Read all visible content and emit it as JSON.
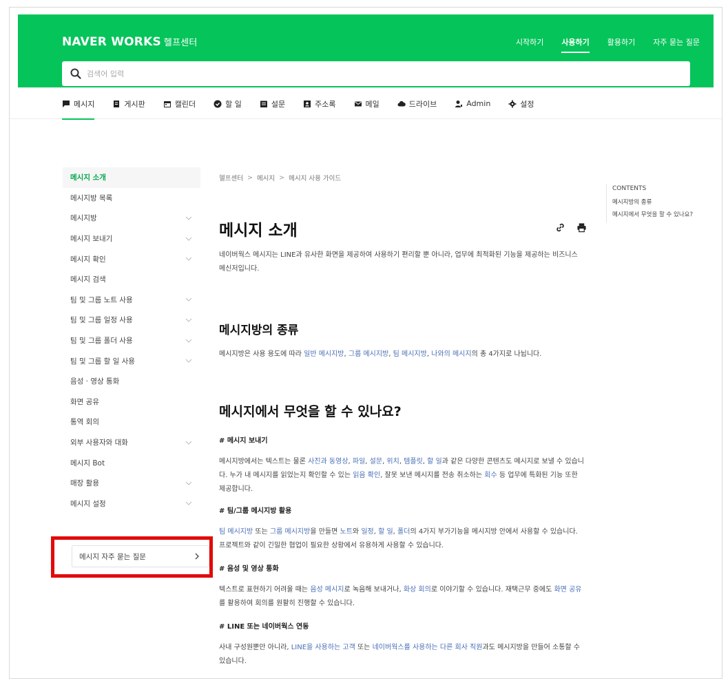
{
  "brand": {
    "name": "NAVER WORKS",
    "sub": "헬프센터"
  },
  "topnav": [
    {
      "label": "시작하기",
      "active": false
    },
    {
      "label": "사용하기",
      "active": true
    },
    {
      "label": "활용하기",
      "active": false
    },
    {
      "label": "자주 묻는 질문",
      "active": false
    }
  ],
  "search": {
    "placeholder": "검색어 입력"
  },
  "tabs": [
    {
      "label": "메시지",
      "icon": "message-icon",
      "active": true
    },
    {
      "label": "게시판",
      "icon": "board-icon"
    },
    {
      "label": "캘린더",
      "icon": "calendar-icon"
    },
    {
      "label": "할 일",
      "icon": "check-circle-icon"
    },
    {
      "label": "설문",
      "icon": "survey-icon"
    },
    {
      "label": "주소록",
      "icon": "contact-icon"
    },
    {
      "label": "메일",
      "icon": "mail-icon"
    },
    {
      "label": "드라이브",
      "icon": "cloud-icon"
    },
    {
      "label": "Admin",
      "icon": "admin-icon"
    },
    {
      "label": "설정",
      "icon": "gear-icon"
    }
  ],
  "sidebar": {
    "items": [
      {
        "label": "메시지 소개",
        "expandable": false,
        "active": true
      },
      {
        "label": "메시지방 목록",
        "expandable": false
      },
      {
        "label": "메시지방",
        "expandable": true
      },
      {
        "label": "메시지 보내기",
        "expandable": true
      },
      {
        "label": "메시지 확인",
        "expandable": true
      },
      {
        "label": "메시지 검색",
        "expandable": false
      },
      {
        "label": "팀 및 그룹 노트 사용",
        "expandable": true
      },
      {
        "label": "팀 및 그룹 일정 사용",
        "expandable": true
      },
      {
        "label": "팀 및 그룹 폴더 사용",
        "expandable": true
      },
      {
        "label": "팀 및 그룹 할 일 사용",
        "expandable": true
      },
      {
        "label": "음성 · 영상 통화",
        "expandable": false
      },
      {
        "label": "화면 공유",
        "expandable": false
      },
      {
        "label": "통역 회의",
        "expandable": false
      },
      {
        "label": "외부 사용자와 대화",
        "expandable": true
      },
      {
        "label": "메시지 Bot",
        "expandable": false
      },
      {
        "label": "매장 활용",
        "expandable": true
      },
      {
        "label": "메시지 설정",
        "expandable": true
      }
    ],
    "faq_label": "메시지 자주 묻는 질문"
  },
  "breadcrumb": [
    "헬프센터",
    "메시지",
    "메시지 사용 가이드"
  ],
  "page": {
    "title": "메시지 소개",
    "intro": "네이버웍스 메시지는 LINE과 유사한 화면을 제공하여 사용하기 편리할 뿐 아니라, 업무에 최적화된 기능을 제공하는 비즈니스 메신저입니다.",
    "s1": {
      "title": "메시지방의 종류",
      "p": [
        {
          "t": "메시지방은 사용 용도에 따라 "
        },
        {
          "t": "일반 메시지방",
          "link": true
        },
        {
          "t": ", "
        },
        {
          "t": "그룹 메시지방",
          "link": true
        },
        {
          "t": ", "
        },
        {
          "t": "팀 메시지방",
          "link": true
        },
        {
          "t": ", "
        },
        {
          "t": "나와의 메시지",
          "link": true
        },
        {
          "t": "의 총 4가지로 나뉩니다."
        }
      ]
    },
    "s2": {
      "title": "메시지에서 무엇을 할 수 있나요?",
      "sub1": {
        "title": "# 메시지 보내기",
        "p": [
          {
            "t": "메시지방에서는 텍스트는 물론 "
          },
          {
            "t": "사진과 동영상",
            "link": true
          },
          {
            "t": ", "
          },
          {
            "t": "파일",
            "link": true
          },
          {
            "t": ", "
          },
          {
            "t": "설문",
            "link": true
          },
          {
            "t": ", "
          },
          {
            "t": "위치",
            "link": true
          },
          {
            "t": ", "
          },
          {
            "t": "템플릿",
            "link": true
          },
          {
            "t": ", "
          },
          {
            "t": "할 일",
            "link": true
          },
          {
            "t": "과 같은 다양한 콘텐츠도 메시지로 보낼 수 있습니다. 누가 내 메시지를 읽었는지 확인할 수 있는 "
          },
          {
            "t": "읽음 확인",
            "link": true
          },
          {
            "t": ", 잘못 보낸 메시지를 전송 취소하는 "
          },
          {
            "t": "회수",
            "link": true
          },
          {
            "t": " 등 업무에 특화된 기능 또한 제공합니다."
          }
        ]
      },
      "sub2": {
        "title": "# 팀/그룹 메시지방 활용",
        "p": [
          {
            "t": "팀 메시지방",
            "link": true
          },
          {
            "t": " 또는 "
          },
          {
            "t": "그룹 메시지방",
            "link": true
          },
          {
            "t": "을 만들면 "
          },
          {
            "t": "노트",
            "link": true
          },
          {
            "t": "와 "
          },
          {
            "t": "일정",
            "link": true
          },
          {
            "t": ", "
          },
          {
            "t": "할 일",
            "link": true
          },
          {
            "t": ", "
          },
          {
            "t": "폴더",
            "link": true
          },
          {
            "t": "의 4가지 부가기능을 메시지방 안에서 사용할 수 있습니다. 프로젝트와 같이 긴밀한 협업이 필요한 상황에서 유용하게 사용할 수 있습니다."
          }
        ]
      },
      "sub3": {
        "title": "# 음성 및 영상 통화",
        "p": [
          {
            "t": "텍스트로 표현하기 어려울 때는 "
          },
          {
            "t": "음성 메시지",
            "link": true
          },
          {
            "t": "로 녹음해 보내거나, "
          },
          {
            "t": "화상 회의",
            "link": true
          },
          {
            "t": "로 이야기할 수 있습니다. 재택근무 중에도 "
          },
          {
            "t": "화면 공유",
            "link": true
          },
          {
            "t": "를 활용하여 회의를 원활히 진행할 수 있습니다."
          }
        ]
      },
      "sub4": {
        "title": "# LINE 또는 네이버웍스 연동",
        "p": [
          {
            "t": "사내 구성원뿐만 아니라, "
          },
          {
            "t": "LINE을 사용하는 고객",
            "link": true
          },
          {
            "t": " 또는 "
          },
          {
            "t": "네이버웍스를 사용하는 다른 회사 직원",
            "link": true
          },
          {
            "t": "과도 메시지방을 만들어 소통할 수 있습니다."
          }
        ]
      }
    }
  },
  "toc": {
    "title": "CONTENTS",
    "items": [
      "메시지방의 종류",
      "메시지에서 무엇을 할 수 있나요?"
    ]
  },
  "colors": {
    "brand_green": "#05c45a",
    "highlight_red": "#e10b0b",
    "link_blue": "#4a6fb6"
  }
}
